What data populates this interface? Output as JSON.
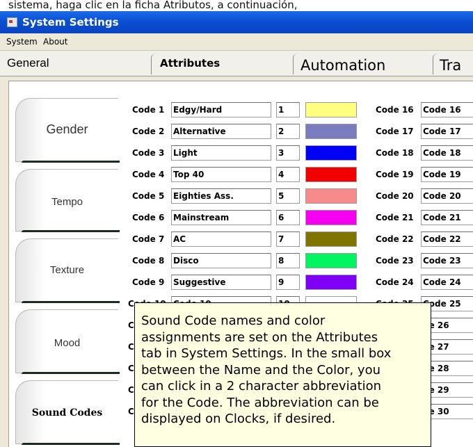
{
  "caption": "sistema, haga clic en la ficha Atributos, a continuación,",
  "window": {
    "title": "System Settings"
  },
  "menu": [
    "System",
    "About"
  ],
  "tabs": [
    "General",
    "Attributes",
    "Automation",
    "Tra"
  ],
  "sidetabs": [
    "Gender",
    "Tempo",
    "Texture",
    "Mood",
    "Sound Codes"
  ],
  "codes_left": [
    {
      "label": "Code 1",
      "name": "Edgy/Hard",
      "abbr": "1",
      "color": "#ffff80"
    },
    {
      "label": "Code 2",
      "name": "Alternative",
      "abbr": "2",
      "color": "#7b7bbf"
    },
    {
      "label": "Code 3",
      "name": "Light",
      "abbr": "3",
      "color": "#0000f5"
    },
    {
      "label": "Code 4",
      "name": "Top 40",
      "abbr": "4",
      "color": "#f20000"
    },
    {
      "label": "Code 5",
      "name": "Eighties Ass.",
      "abbr": "5",
      "color": "#f78a8a"
    },
    {
      "label": "Code 6",
      "name": "Mainstream",
      "abbr": "6",
      "color": "#f500f0"
    },
    {
      "label": "Code 7",
      "name": "AC",
      "abbr": "7",
      "color": "#807400"
    },
    {
      "label": "Code 8",
      "name": "Disco",
      "abbr": "8",
      "color": "#00f560"
    },
    {
      "label": "Code 9",
      "name": "Suggestive",
      "abbr": "9",
      "color": "#7f00f5"
    },
    {
      "label": "Code 10",
      "name": "Code 10",
      "abbr": "10",
      "color": "#ffffff"
    }
  ],
  "codes_right": [
    {
      "label": "Code 16",
      "name": "Code 16"
    },
    {
      "label": "Code 17",
      "name": "Code 17"
    },
    {
      "label": "Code 18",
      "name": "Code 18"
    },
    {
      "label": "Code 19",
      "name": "Code 19"
    },
    {
      "label": "Code 20",
      "name": "Code 20"
    },
    {
      "label": "Code 21",
      "name": "Code 21"
    },
    {
      "label": "Code 22",
      "name": "Code 22"
    },
    {
      "label": "Code 23",
      "name": "Code 23"
    },
    {
      "label": "Code 24",
      "name": "Code 24"
    },
    {
      "label": "Code 25",
      "name": "Code 25"
    },
    {
      "label": "",
      "name": "de 26"
    },
    {
      "label": "",
      "name": "de 27"
    },
    {
      "label": "",
      "name": "de 28"
    },
    {
      "label": "",
      "name": "de 29"
    },
    {
      "label": "",
      "name": "de 30"
    }
  ],
  "partial_left_labels": [
    "C",
    "C",
    "C",
    "C",
    "C"
  ],
  "tooltip": {
    "lines": [
      "Sound Code names and color",
      "assignments are set on the Attributes",
      "tab in System Settings.  In the small box",
      "between the Name and the Color, you",
      "can click in a 2 character abbreviation",
      "for the Code. The abbreviation can be",
      "displayed on Clocks, if desired."
    ]
  }
}
